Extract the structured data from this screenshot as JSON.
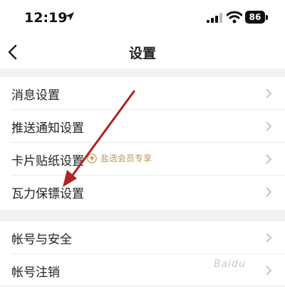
{
  "status_bar": {
    "time": "12:19",
    "battery_level": "86",
    "location_icon": "location-arrow-icon",
    "signal_icon": "cellular-signal-icon",
    "wifi_icon": "wifi-icon"
  },
  "nav": {
    "title": "设置",
    "back_icon": "chevron-left-icon"
  },
  "settings_group_1": [
    {
      "label": "消息设置"
    },
    {
      "label": "推送通知设置"
    },
    {
      "label": "卡片贴纸设置",
      "badge": "盐选会员专享"
    },
    {
      "label": "瓦力保镖设置"
    }
  ],
  "settings_group_2": [
    {
      "label": "帐号与安全"
    },
    {
      "label": "帐号注销"
    }
  ],
  "annotation": {
    "arrow_color": "#b22222"
  },
  "watermark": "Baidu"
}
